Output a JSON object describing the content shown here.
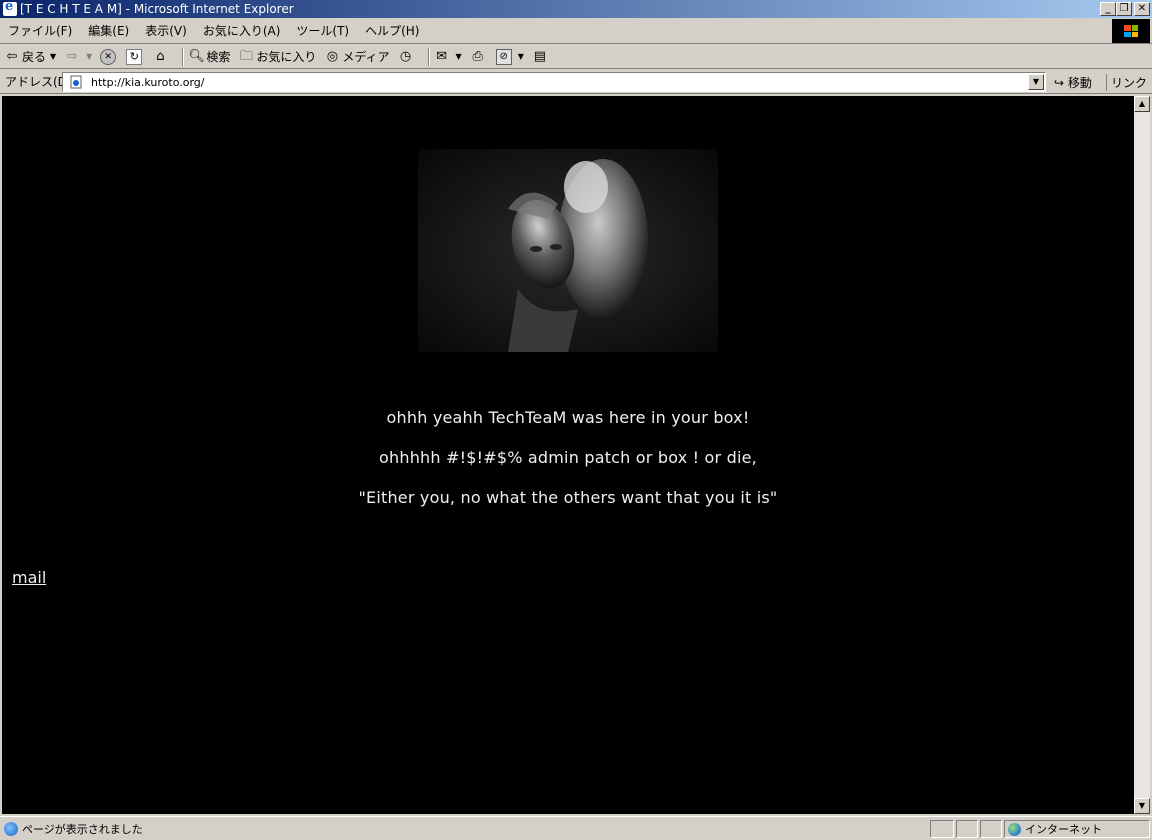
{
  "window": {
    "title": "[T E C H T E A M] - Microsoft Internet Explorer",
    "minimize_glyph": "_",
    "restore_glyph": "❐",
    "close_glyph": "✕"
  },
  "menu": {
    "items": [
      {
        "label": "ファイル(F)"
      },
      {
        "label": "編集(E)"
      },
      {
        "label": "表示(V)"
      },
      {
        "label": "お気に入り(A)"
      },
      {
        "label": "ツール(T)"
      },
      {
        "label": "ヘルプ(H)"
      }
    ]
  },
  "toolbar": {
    "back_label": "戻る",
    "search_label": "検索",
    "favorites_label": "お気に入り",
    "media_label": "メディア"
  },
  "address": {
    "label": "アドレス(D)",
    "url": "http://kia.kuroto.org/",
    "go_label": "移動",
    "links_label": "リンク »"
  },
  "page": {
    "line1": "ohhh yeahh TechTeaM was here in your box!",
    "line2": "ohhhhh #!$!#$% admin patch or box ! or die,",
    "line3": "\"Either you, no what the others want that you it is\"",
    "mail_label": "mail"
  },
  "status": {
    "text": "ページが表示されました",
    "zone": "インターネット"
  },
  "colors": {
    "titlebar_start": "#0a246a",
    "titlebar_end": "#a6caf0",
    "chrome": "#d4d0c8",
    "page_bg": "#000000",
    "page_text": "#f0f0f0"
  }
}
